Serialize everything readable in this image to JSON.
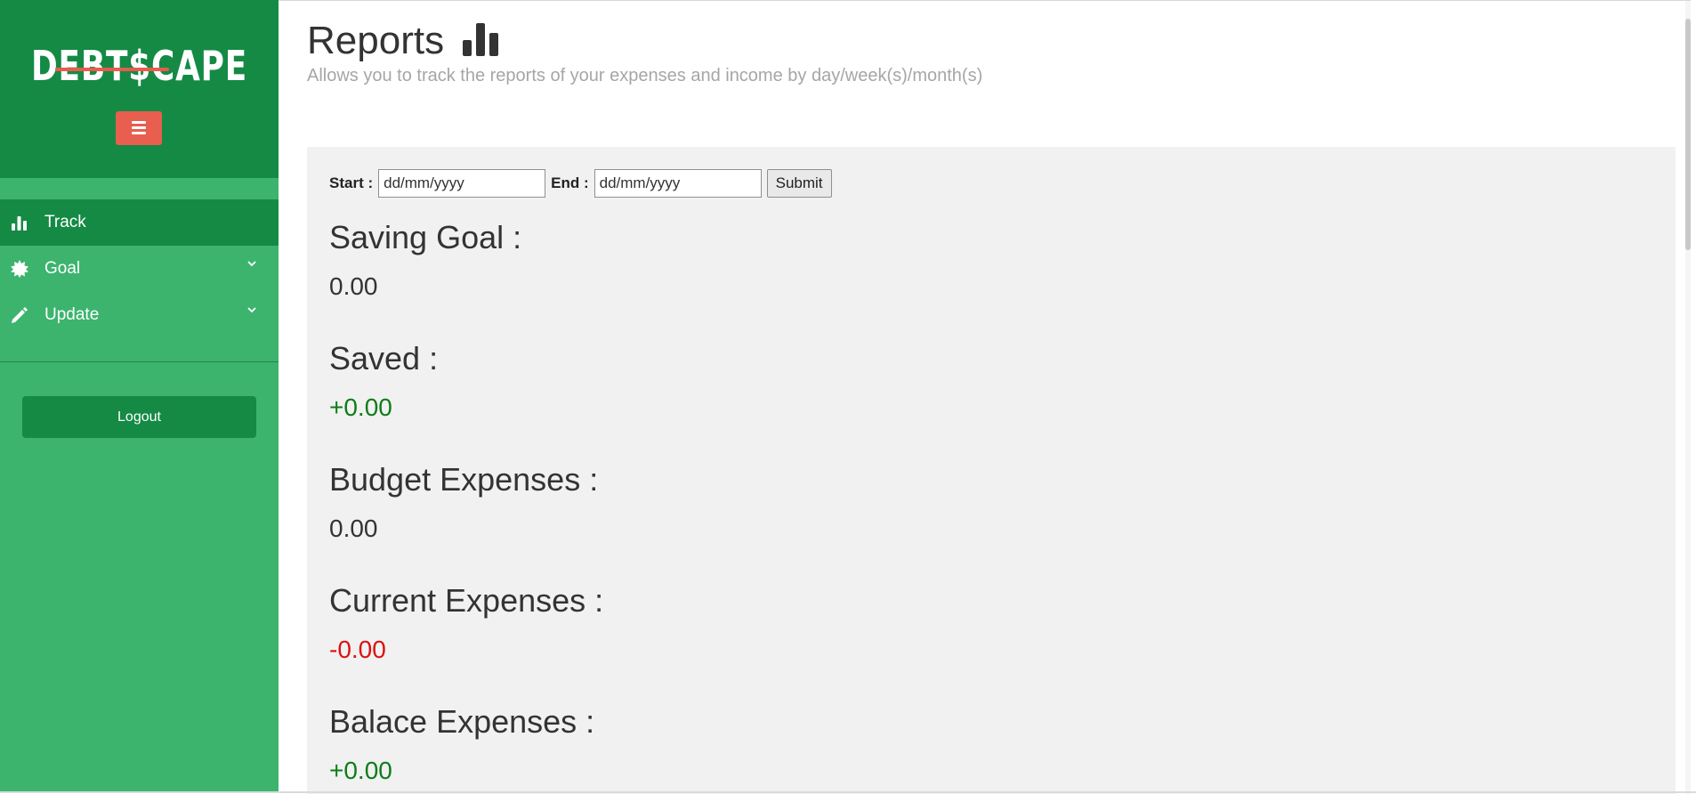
{
  "sidebar": {
    "logo_text": "DEBT$CAPE",
    "nav": [
      {
        "label": "Track",
        "icon": "bar-chart-icon",
        "active": true
      },
      {
        "label": "Goal",
        "icon": "badge-icon",
        "has_submenu": true
      },
      {
        "label": "Update",
        "icon": "pencil-icon",
        "has_submenu": true
      }
    ],
    "logout_label": "Logout"
  },
  "header": {
    "title": "Reports",
    "title_icon": "bar-chart-icon",
    "subtitle": "Allows you to track the reports of your expenses and income by day/week(s)/month(s)"
  },
  "filter": {
    "start_label": "Start :",
    "start_value": "dd/mm/yyyy",
    "end_label": "End :",
    "end_value": "dd/mm/yyyy",
    "submit_label": "Submit"
  },
  "stats": [
    {
      "label": "Saving Goal :",
      "value": "0.00",
      "tone": "neutral"
    },
    {
      "label": "Saved :",
      "value": "+0.00",
      "tone": "positive"
    },
    {
      "label": "Budget Expenses :",
      "value": "0.00",
      "tone": "neutral"
    },
    {
      "label": "Current Expenses :",
      "value": "-0.00",
      "tone": "negative"
    },
    {
      "label": "Balace Expenses :",
      "value": "+0.00",
      "tone": "positive"
    }
  ],
  "colors": {
    "sidebar_dark": "#148a45",
    "sidebar_light": "#3cb46e",
    "toggle_accent": "#e85e4f",
    "positive": "#0d7d18",
    "negative": "#dd1111"
  }
}
